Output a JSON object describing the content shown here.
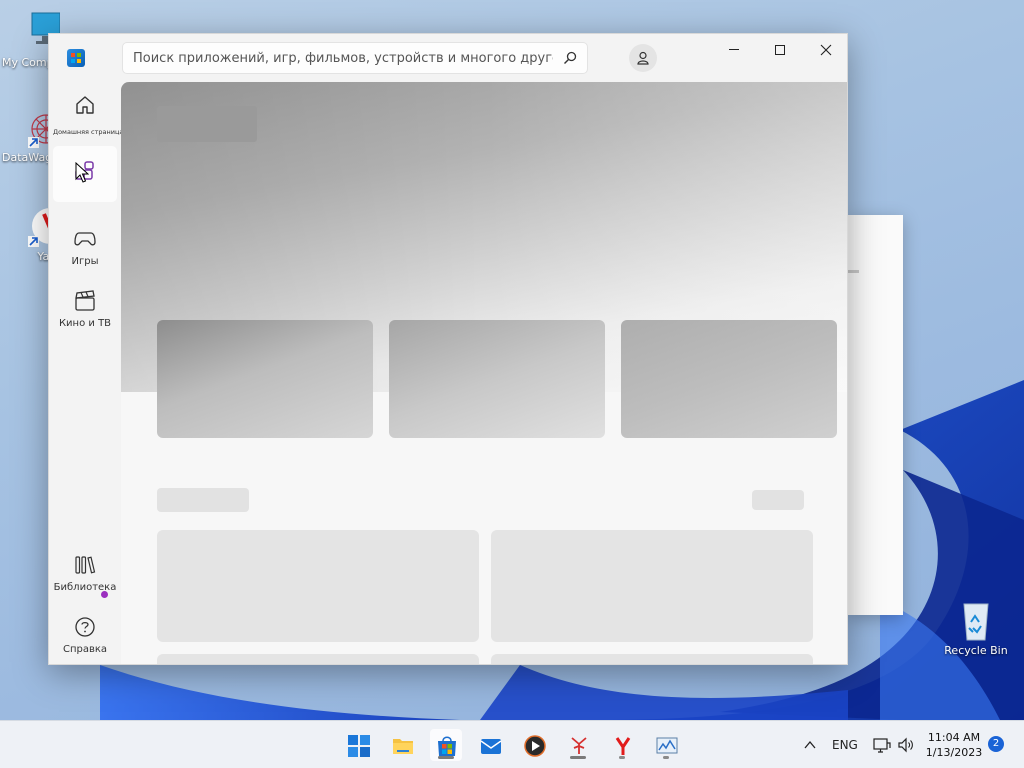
{
  "desktop": {
    "icons": [
      {
        "label": "My Comp"
      },
      {
        "label": "DataWag"
      },
      {
        "label": "Yande"
      }
    ],
    "recycle_bin": "Recycle Bin"
  },
  "store": {
    "search": {
      "placeholder": "Поиск приложений, игр, фильмов, устройств и многого другого"
    },
    "nav": {
      "home": "Домашняя страница",
      "apps": "",
      "games": "Игры",
      "movies": "Кино и ТВ",
      "library": "Библиотека",
      "help": "Справка"
    }
  },
  "taskbar": {
    "language": "ENG",
    "time": "11:04 AM",
    "date": "1/13/2023",
    "notifications": "2"
  },
  "colors": {
    "accent": "#7a3aa8",
    "badge": "#1a63d6"
  }
}
